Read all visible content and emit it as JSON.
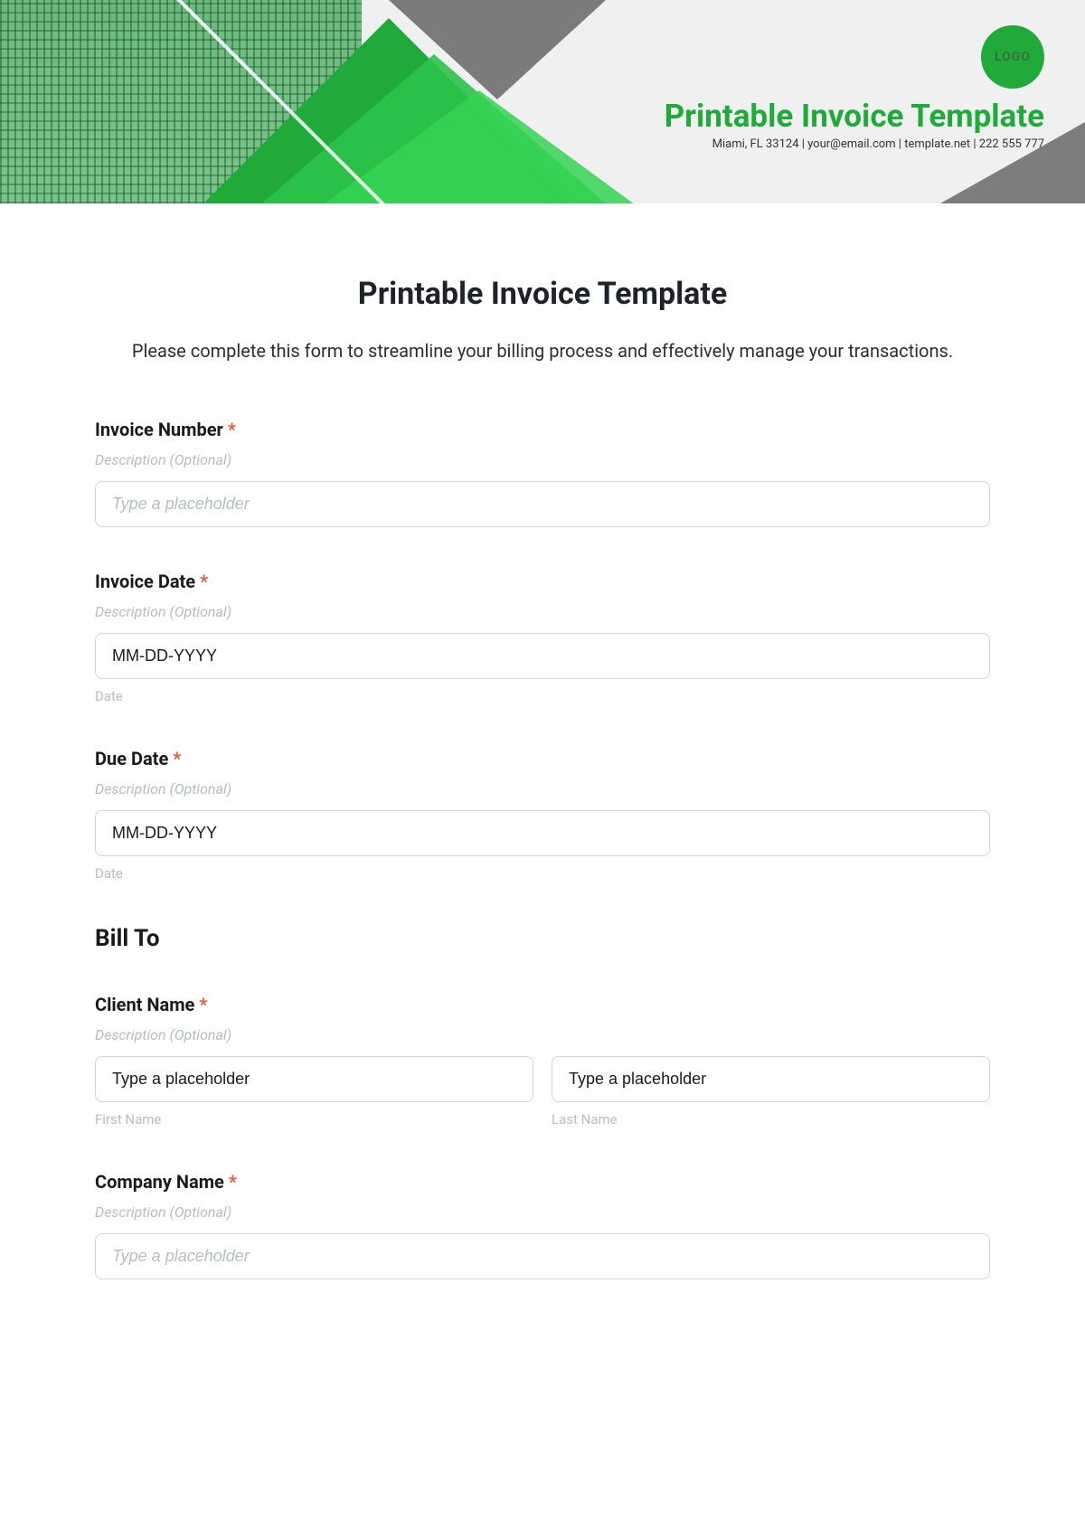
{
  "banner": {
    "logo_text": "LOGO",
    "title": "Printable Invoice Template",
    "sub": "Miami, FL 33124 | your@email.com | template.net | 222 555 777"
  },
  "header": {
    "title": "Printable Invoice Template",
    "description": "Please complete this form to streamline your billing process and effectively manage your transactions."
  },
  "fields": {
    "invoice_number": {
      "label": "Invoice Number",
      "desc": "Description (Optional)",
      "placeholder": "Type a placeholder"
    },
    "invoice_date": {
      "label": "Invoice Date",
      "desc": "Description (Optional)",
      "value": "MM-DD-YYYY",
      "sublabel": "Date"
    },
    "due_date": {
      "label": "Due Date",
      "desc": "Description (Optional)",
      "value": "MM-DD-YYYY",
      "sublabel": "Date"
    },
    "bill_to_heading": "Bill To",
    "client_name": {
      "label": "Client Name",
      "desc": "Description (Optional)",
      "first_placeholder": "Type a placeholder",
      "last_placeholder": "Type a placeholder",
      "first_sublabel": "First Name",
      "last_sublabel": "Last Name"
    },
    "company_name": {
      "label": "Company Name",
      "desc": "Description (Optional)",
      "placeholder": "Type a placeholder"
    },
    "required_mark": "*"
  }
}
